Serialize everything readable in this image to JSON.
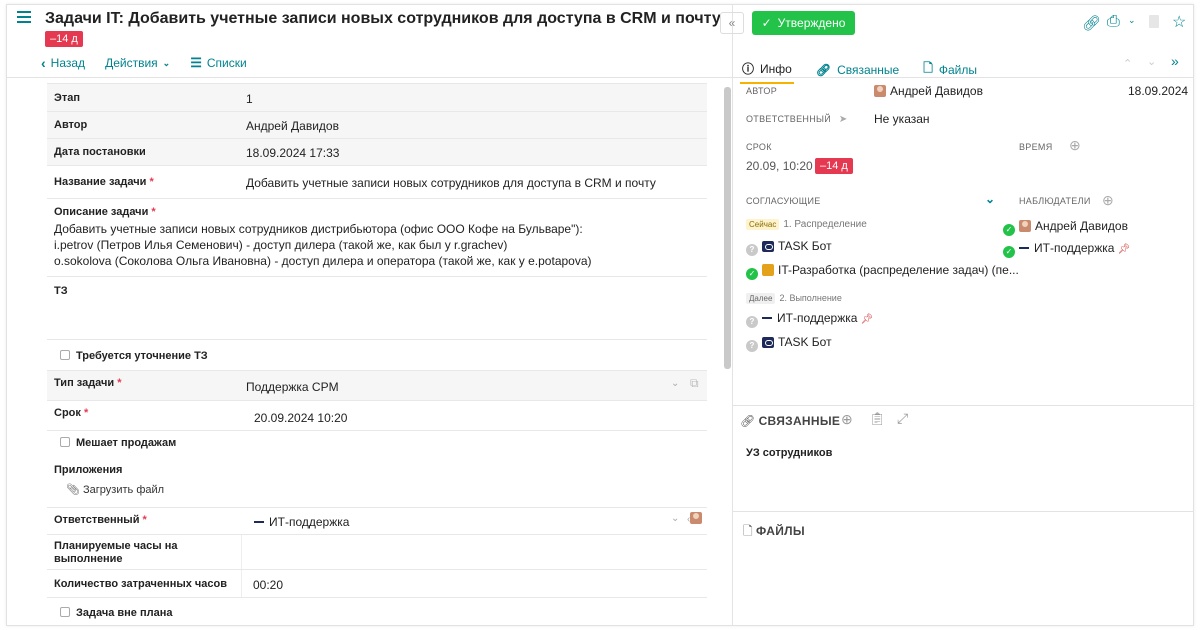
{
  "header": {
    "title": "Задачи IT: Добавить учетные записи новых сотрудников для доступа в CRM и почту",
    "overdue": "–14 д",
    "approved": "Утверждено"
  },
  "toolbar": {
    "back": "Назад",
    "actions": "Действия",
    "lists": "Списки"
  },
  "form": {
    "stage_label": "Этап",
    "stage_value": "1",
    "author_label": "Автор",
    "author_value": "Андрей Давидов",
    "date_label": "Дата постановки",
    "date_value": "18.09.2024 17:33",
    "name_label": "Название задачи",
    "name_value": "Добавить учетные записи новых сотрудников для доступа в CRM и почту",
    "desc_label": "Описание задачи",
    "desc_lines": [
      "Добавить учетные записи новых сотрудников дистрибьютора (офис ООО Кофе на Бульваре\"):",
      "i.petrov (Петров Илья Семенович) - доступ дилера (такой же, как был у r.grachev)",
      "o.sokolova (Соколова Ольга Ивановна) - доступ дилера и оператора (такой же, как у e.potapova)"
    ],
    "tz_label": "ТЗ",
    "tz_clarify": "Требуется уточнение ТЗ",
    "type_label": "Тип задачи",
    "type_value": "Поддержка CPM",
    "deadline_label": "Срок",
    "deadline_value": "20.09.2024 10:20",
    "sales_label": "Мешает продажам",
    "attach_label": "Приложения",
    "upload": "Загрузить файл",
    "resp_label": "Ответственный",
    "resp_value": "ИТ-поддержка",
    "planned_label": "Планируемые часы на выполнение",
    "spent_label": "Количество затраченных часов",
    "spent_value": "00:20",
    "unplanned_label": "Задача вне плана"
  },
  "tabs": [
    "Инфо",
    "Связанные",
    "Файлы"
  ],
  "info": {
    "author_label": "Автор",
    "author_value": "Андрей Давидов",
    "author_date": "18.09.2024",
    "resp_label": "Ответственный",
    "resp_value": "Не указан",
    "deadline_label": "Срок",
    "deadline_value": "20.09, 10:20",
    "deadline_badge": "–14 д",
    "time_label": "Время",
    "approvers_label": "Согласующие",
    "observers_label": "Наблюдатели",
    "now_chip": "Сейчас",
    "stage1": "1. Распределение",
    "task_bot": "TASK Бот",
    "it_dev": "IT-Разработка (распределение задач) (пе...",
    "next_chip": "Далее",
    "stage2": "2. Выполнение",
    "it_support": "ИТ-поддержка",
    "observer1": "Андрей Давидов",
    "observer2": "ИТ-поддержка"
  },
  "related": {
    "label": "Связанные",
    "item": "УЗ сотрудников"
  },
  "files": {
    "label": "Файлы"
  }
}
